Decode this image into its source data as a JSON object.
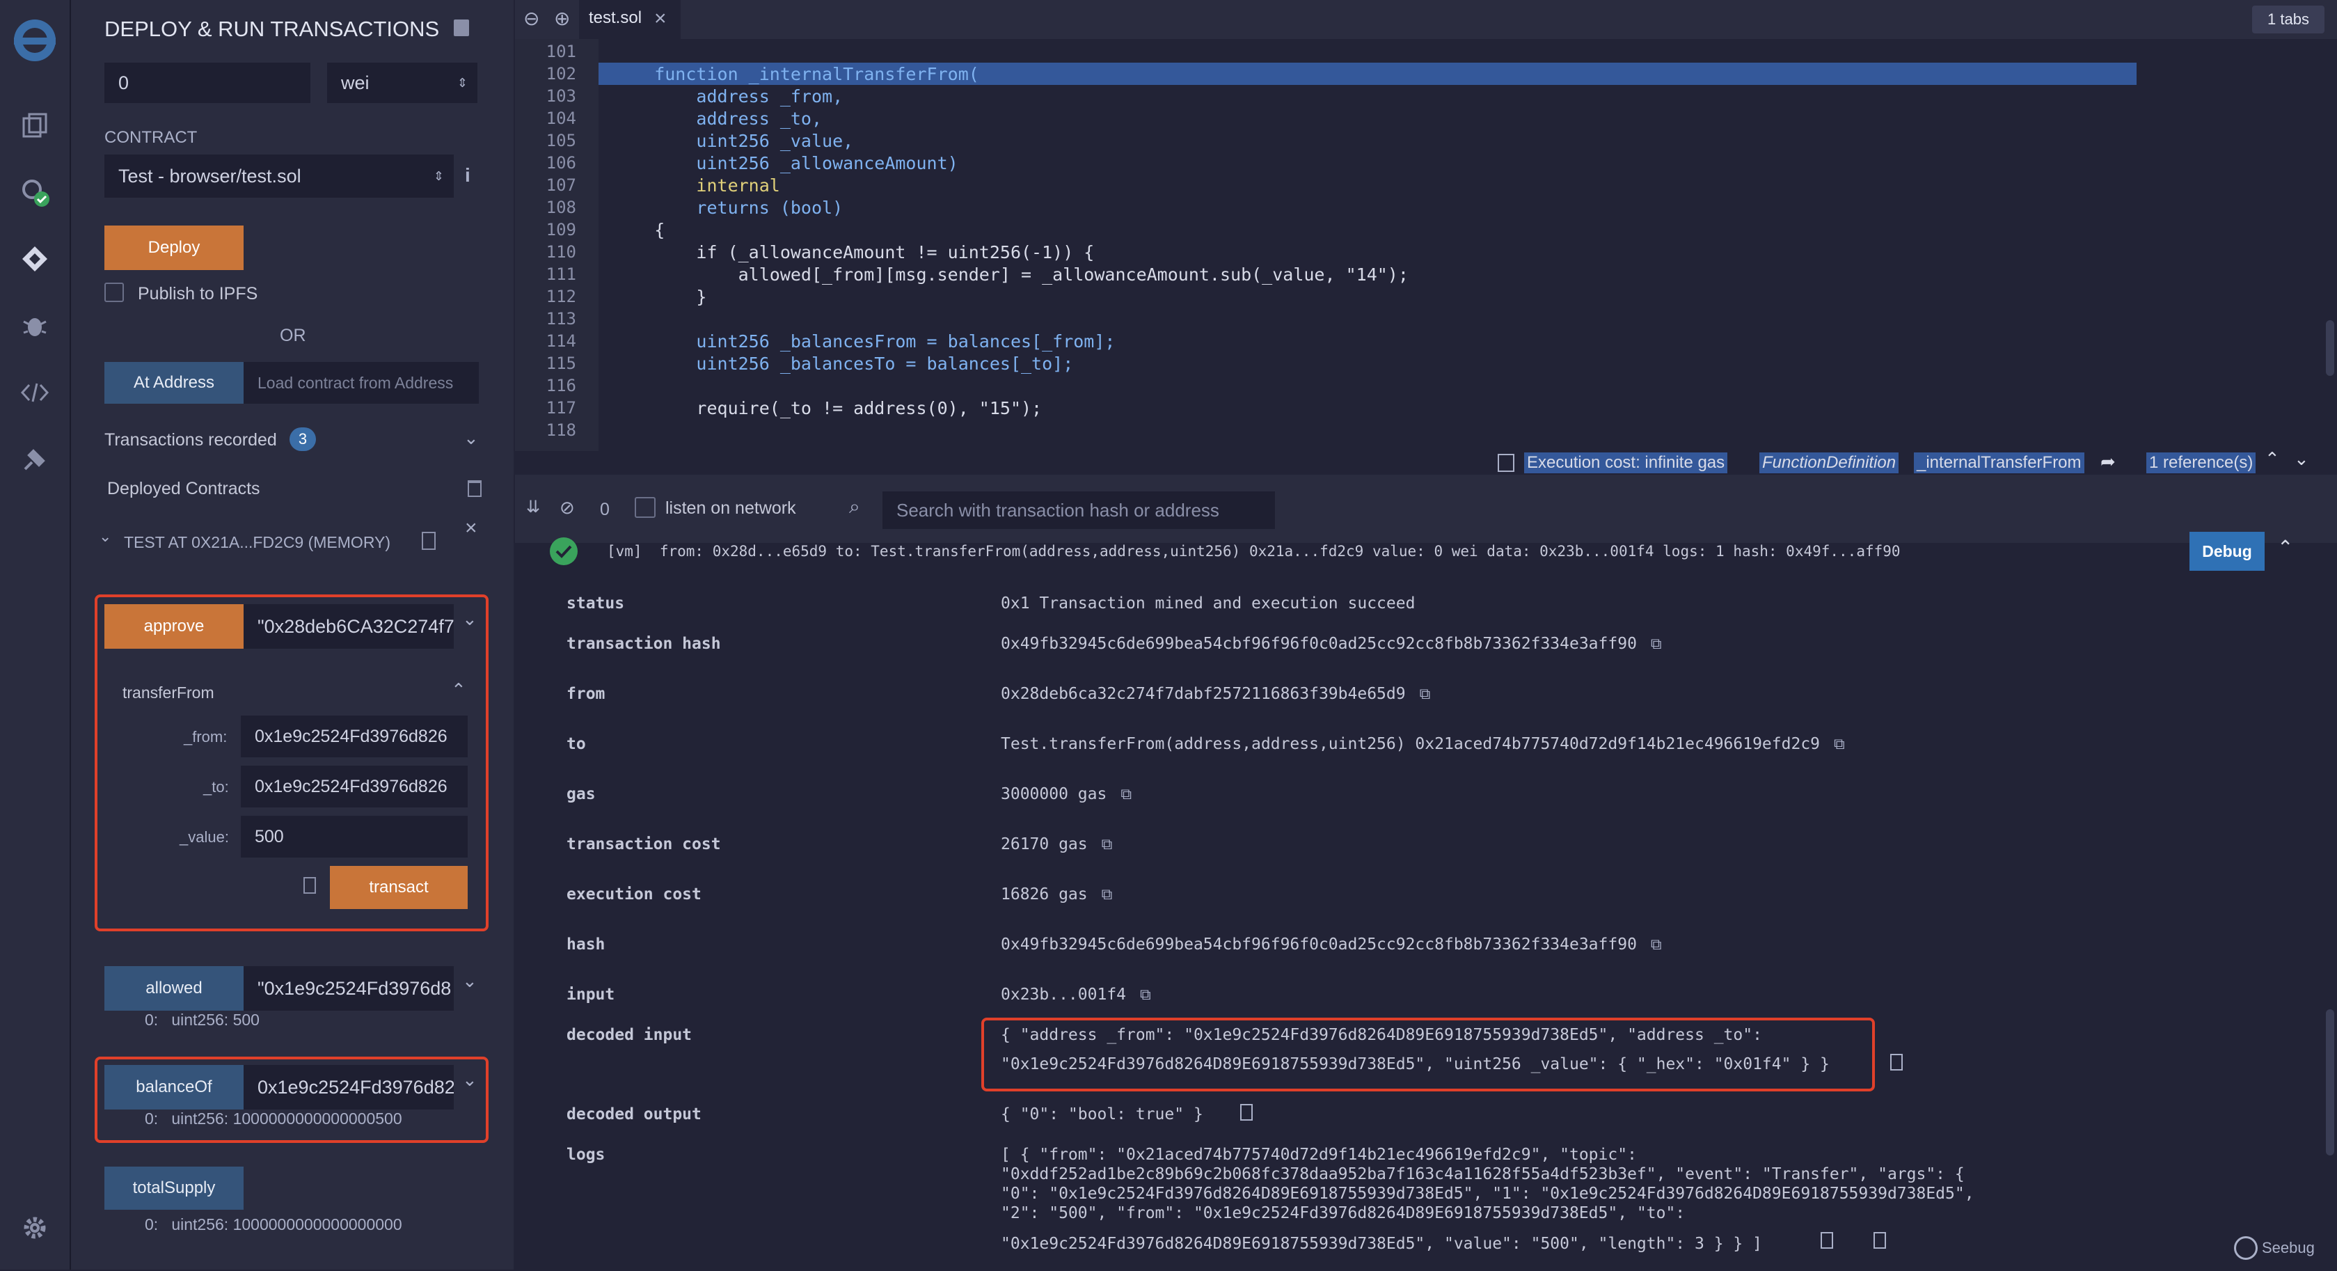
{
  "panel": {
    "title": "DEPLOY & RUN TRANSACTIONS",
    "value_input": "0",
    "value_unit": "wei",
    "contract_label": "CONTRACT",
    "contract_select": "Test - browser/test.sol",
    "deploy_label": "Deploy",
    "publish_label": "Publish to IPFS",
    "or_label": "OR",
    "at_address_label": "At Address",
    "load_placeholder": "Load contract from Address",
    "tx_recorded_label": "Transactions recorded",
    "tx_recorded_count": "3",
    "deployed_label": "Deployed Contracts",
    "instance_label": "TEST AT 0X21A...FD2C9 (MEMORY)",
    "approve_label": "approve",
    "approve_value": "\"0x28deb6CA32C274f7",
    "transferFrom_label": "transferFrom",
    "from_label": "_from:",
    "from_value": "0x1e9c2524Fd3976d826",
    "to_label": "_to:",
    "to_value": "0x1e9c2524Fd3976d826",
    "value_label": "_value:",
    "value_value": "500",
    "transact_label": "transact",
    "allowed_label": "allowed",
    "allowed_value": "\"0x1e9c2524Fd3976d8",
    "allowed_result": "0:   uint256: 500",
    "balanceOf_label": "balanceOf",
    "balanceOf_value": "0x1e9c2524Fd3976d82",
    "balanceOf_result": "0:   uint256: 1000000000000000500",
    "totalSupply_label": "totalSupply",
    "totalSupply_result": "0:   uint256: 1000000000000000000"
  },
  "editor": {
    "tab_name": "test.sol",
    "tabs_badge": "1 tabs",
    "lines": [
      {
        "n": "101",
        "code": ""
      },
      {
        "n": "102",
        "code": "    function _internalTransferFrom("
      },
      {
        "n": "103",
        "code": "        address _from,"
      },
      {
        "n": "104",
        "code": "        address _to,"
      },
      {
        "n": "105",
        "code": "        uint256 _value,"
      },
      {
        "n": "106",
        "code": "        uint256 _allowanceAmount)"
      },
      {
        "n": "107",
        "code": "        internal"
      },
      {
        "n": "108",
        "code": "        returns (bool)"
      },
      {
        "n": "109",
        "code": "    {"
      },
      {
        "n": "110",
        "code": "        if (_allowanceAmount != uint256(-1)) {"
      },
      {
        "n": "111",
        "code": "            allowed[_from][msg.sender] = _allowanceAmount.sub(_value, \"14\");"
      },
      {
        "n": "112",
        "code": "        }"
      },
      {
        "n": "113",
        "code": ""
      },
      {
        "n": "114",
        "code": "        uint256 _balancesFrom = balances[_from];"
      },
      {
        "n": "115",
        "code": "        uint256 _balancesTo = balances[_to];"
      },
      {
        "n": "116",
        "code": ""
      },
      {
        "n": "117",
        "code": "        require(_to != address(0), \"15\");"
      },
      {
        "n": "118",
        "code": ""
      }
    ],
    "status_exec": "Execution cost: infinite gas",
    "status_fn": "FunctionDefinition",
    "status_name": "_internalTransferFrom",
    "status_refs": "1 reference(s)"
  },
  "terminal": {
    "count": "0",
    "listen_label": "listen on network",
    "search_placeholder": "Search with transaction hash or address",
    "summary": "[vm]  from: 0x28d...e65d9 to: Test.transferFrom(address,address,uint256) 0x21a...fd2c9 value: 0 wei data: 0x23b...001f4 logs: 1 hash: 0x49f...aff90",
    "debug_label": "Debug",
    "rows": [
      {
        "k": "status",
        "v": "0x1 Transaction mined and execution succeed"
      },
      {
        "k": "transaction hash",
        "v": "0x49fb32945c6de699bea54cbf96f96f0c0ad25cc92cc8fb8b73362f334e3aff90"
      },
      {
        "k": "from",
        "v": "0x28deb6ca32c274f7dabf2572116863f39b4e65d9"
      },
      {
        "k": "to",
        "v": "Test.transferFrom(address,address,uint256) 0x21aced74b775740d72d9f14b21ec496619efd2c9"
      },
      {
        "k": "gas",
        "v": "3000000 gas"
      },
      {
        "k": "transaction cost",
        "v": "26170 gas"
      },
      {
        "k": "execution cost",
        "v": "16826 gas"
      },
      {
        "k": "hash",
        "v": "0x49fb32945c6de699bea54cbf96f96f0c0ad25cc92cc8fb8b73362f334e3aff90"
      },
      {
        "k": "input",
        "v": "0x23b...001f4"
      }
    ],
    "decoded_input_key": "decoded input",
    "decoded_input_1": "{ \"address _from\": \"0x1e9c2524Fd3976d8264D89E6918755939d738Ed5\", \"address _to\":",
    "decoded_input_2": "\"0x1e9c2524Fd3976d8264D89E6918755939d738Ed5\", \"uint256 _value\": { \"_hex\": \"0x01f4\" } }",
    "decoded_output_key": "decoded output",
    "decoded_output": "{ \"0\": \"bool: true\" }",
    "logs_key": "logs",
    "logs_1": "[ { \"from\": \"0x21aced74b775740d72d9f14b21ec496619efd2c9\", \"topic\":",
    "logs_2": "\"0xddf252ad1be2c89b69c2b068fc378daa952ba7f163c4a11628f55a4df523b3ef\", \"event\": \"Transfer\", \"args\": {",
    "logs_3": "\"0\": \"0x1e9c2524Fd3976d8264D89E6918755939d738Ed5\", \"1\": \"0x1e9c2524Fd3976d8264D89E6918755939d738Ed5\",",
    "logs_4": "\"2\": \"500\", \"from\": \"0x1e9c2524Fd3976d8264D89E6918755939d738Ed5\", \"to\":",
    "logs_5": "\"0x1e9c2524Fd3976d8264D89E6918755939d738Ed5\", \"value\": \"500\", \"length\": 3 } } ]",
    "watermark": "Seebug"
  },
  "colors": {
    "accent_orange": "#c97539",
    "accent_blue": "#35547a",
    "highlight": "#34589a",
    "red_box": "#e0402a"
  }
}
